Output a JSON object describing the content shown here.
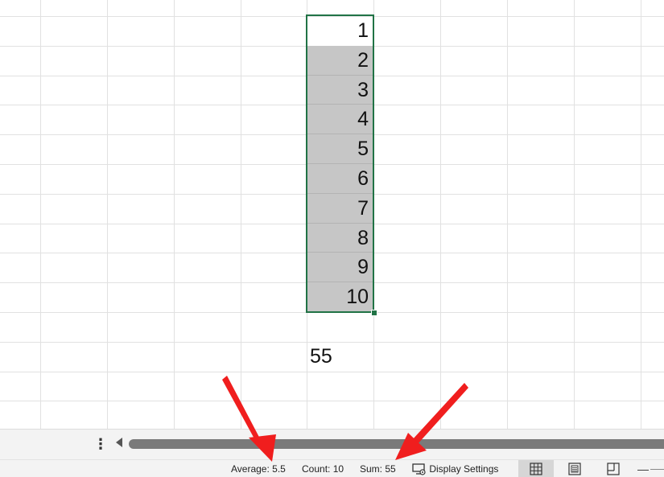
{
  "sheet": {
    "selected_values": [
      "1",
      "2",
      "3",
      "4",
      "5",
      "6",
      "7",
      "8",
      "9",
      "10"
    ],
    "result_value": "55"
  },
  "scroll": {
    "sheet_options_icon": "vertical-ellipsis-icon",
    "scroll_left_icon": "scroll-left-arrow-icon"
  },
  "status_bar": {
    "average": "Average: 5.5",
    "count": "Count: 10",
    "sum": "Sum: 55",
    "display_settings": "Display Settings",
    "zoom_out_symbol": "—"
  },
  "colors": {
    "selection_border": "#217346",
    "selection_fill": "#c6c6c6",
    "annotation_arrow": "#f01e1e"
  }
}
